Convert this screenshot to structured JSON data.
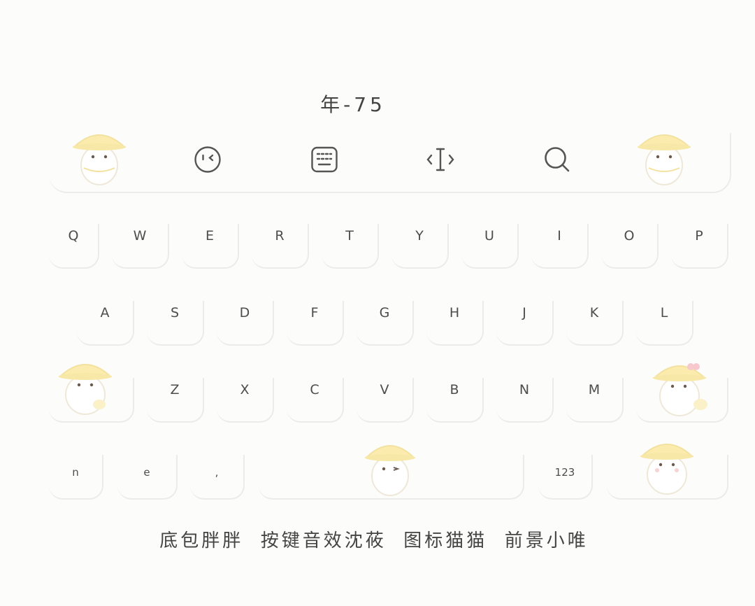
{
  "title": "年-75",
  "toolbar": {
    "icons": [
      "emoji-icon",
      "keyboard-icon",
      "cursor-icon",
      "search-icon"
    ]
  },
  "keyboard": {
    "row1": [
      "Q",
      "W",
      "E",
      "R",
      "T",
      "Y",
      "U",
      "I",
      "O",
      "P"
    ],
    "row2": [
      "A",
      "S",
      "D",
      "F",
      "G",
      "H",
      "J",
      "K",
      "L"
    ],
    "row3": [
      "Z",
      "X",
      "C",
      "V",
      "B",
      "N",
      "M"
    ],
    "row4": [
      "n",
      "e",
      ",",
      "123"
    ]
  },
  "footer": "底包胖胖  按键音效沈莜  图标猫猫  前景小唯",
  "colors": {
    "background": "#fcfcfb",
    "key_text": "#4d4d4d",
    "key_edge": "#ebebeb",
    "sticker_hat": "#fbecae"
  }
}
